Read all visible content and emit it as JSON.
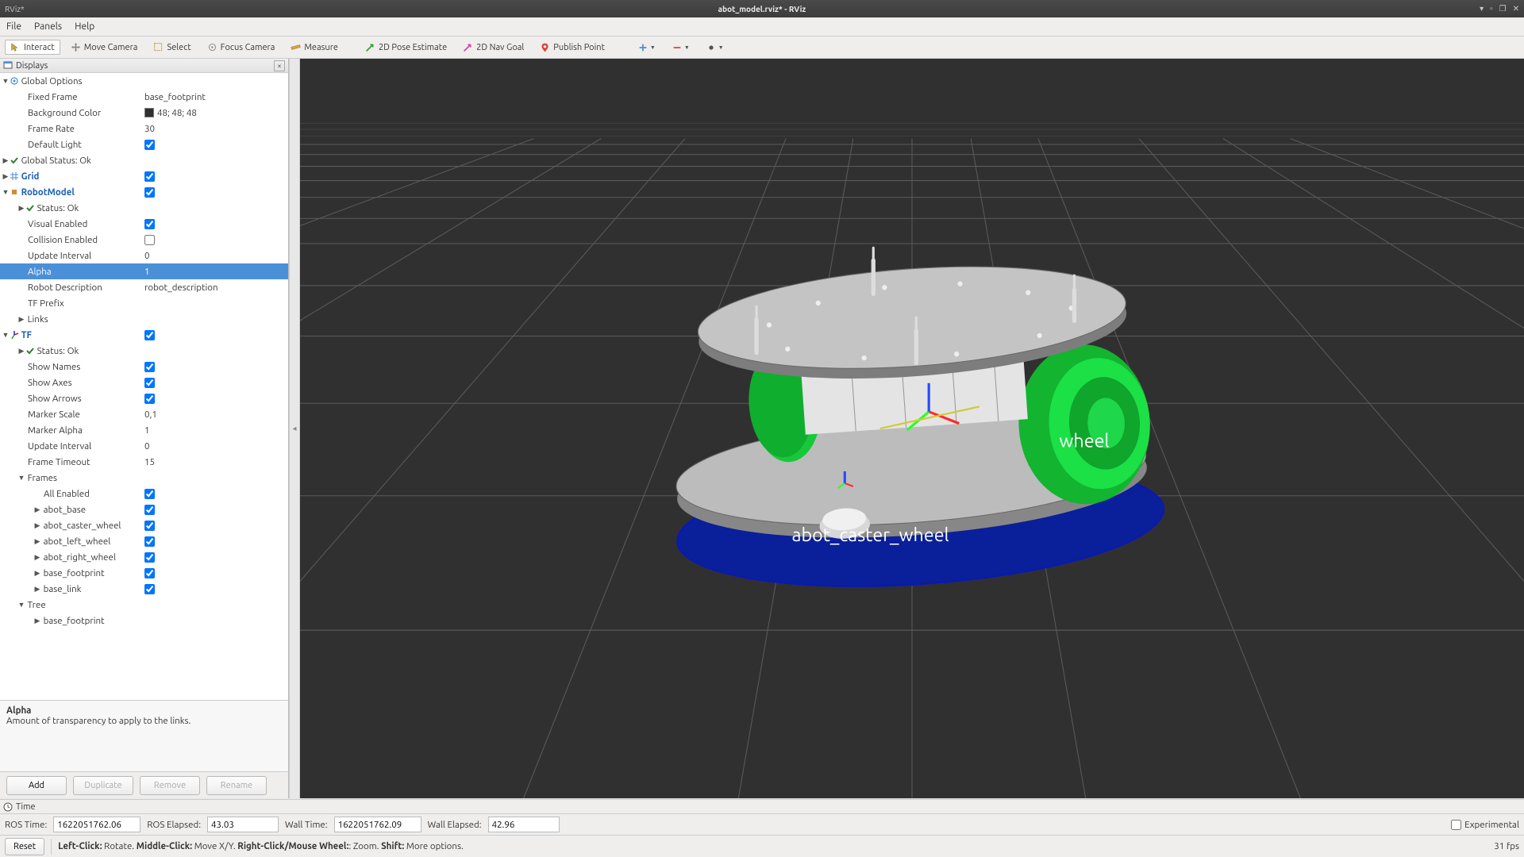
{
  "window": {
    "app": "RViz*",
    "title": "abot_model.rviz* - RViz"
  },
  "menu": {
    "file": "File",
    "panels": "Panels",
    "help": "Help"
  },
  "toolbar": {
    "interact": "Interact",
    "move": "Move Camera",
    "select": "Select",
    "focus": "Focus Camera",
    "measure": "Measure",
    "pose": "2D Pose Estimate",
    "nav": "2D Nav Goal",
    "publish": "Publish Point"
  },
  "displays": {
    "title": "Displays",
    "items": {
      "global_options": "Global Options",
      "fixed_frame": "Fixed Frame",
      "fixed_frame_v": "base_footprint",
      "bgcolor": "Background Color",
      "bgcolor_v": "48; 48; 48",
      "framerate": "Frame Rate",
      "framerate_v": "30",
      "default_light": "Default Light",
      "global_status": "Global Status: Ok",
      "grid": "Grid",
      "robot_model": "RobotModel",
      "rm_status": "Status: Ok",
      "visual_enabled": "Visual Enabled",
      "collision_enabled": "Collision Enabled",
      "update_interval": "Update Interval",
      "update_interval_v": "0",
      "alpha": "Alpha",
      "alpha_v": "1",
      "robot_desc": "Robot Description",
      "robot_desc_v": "robot_description",
      "tf_prefix": "TF Prefix",
      "links": "Links",
      "tf": "TF",
      "tf_status": "Status: Ok",
      "show_names": "Show Names",
      "show_axes": "Show Axes",
      "show_arrows": "Show Arrows",
      "marker_scale": "Marker Scale",
      "marker_scale_v": "0,1",
      "marker_alpha": "Marker Alpha",
      "marker_alpha_v": "1",
      "update_interval2": "Update Interval",
      "update_interval2_v": "0",
      "frame_timeout": "Frame Timeout",
      "frame_timeout_v": "15",
      "frames": "Frames",
      "all_enabled": "All Enabled",
      "f_abot_base": "abot_base",
      "f_caster": "abot_caster_wheel",
      "f_left": "abot_left_wheel",
      "f_right": "abot_right_wheel",
      "f_footprint": "base_footprint",
      "f_link": "base_link",
      "tree": "Tree",
      "tree_footprint": "base_footprint"
    },
    "help_title": "Alpha",
    "help_text": "Amount of transparency to apply to the links.",
    "buttons": {
      "add": "Add",
      "duplicate": "Duplicate",
      "remove": "Remove",
      "rename": "Rename"
    }
  },
  "viewport_labels": {
    "caster": "abot_caster_wheel",
    "wheel": "wheel"
  },
  "time": {
    "title": "Time",
    "ros_time": "ROS Time:",
    "ros_time_v": "1622051762.06",
    "ros_elapsed": "ROS Elapsed:",
    "ros_elapsed_v": "43.03",
    "wall_time": "Wall Time:",
    "wall_time_v": "1622051762.09",
    "wall_elapsed": "Wall Elapsed:",
    "wall_elapsed_v": "42.96",
    "experimental": "Experimental"
  },
  "status": {
    "reset": "Reset",
    "hint_lc": "Left-Click:",
    "hint_lc_v": " Rotate. ",
    "hint_mc": "Middle-Click:",
    "hint_mc_v": " Move X/Y. ",
    "hint_rc": "Right-Click/Mouse Wheel:",
    "hint_rc_v": ": Zoom. ",
    "hint_sh": "Shift:",
    "hint_sh_v": " More options.",
    "fps": "31 fps"
  }
}
